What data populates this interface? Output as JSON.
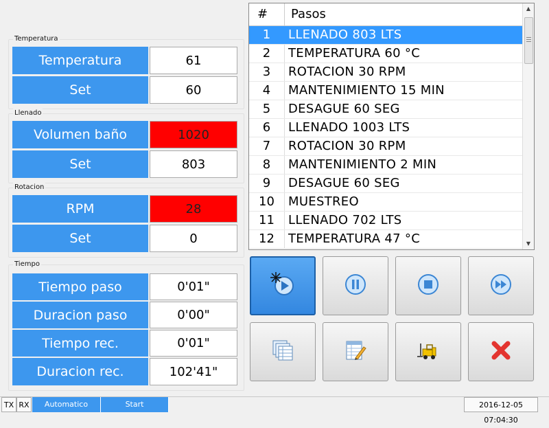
{
  "temperatura": {
    "group_title": "Temperatura",
    "main_label": "Temperatura",
    "main_value": "61",
    "set_label": "Set",
    "set_value": "60"
  },
  "llenado": {
    "group_title": "Llenado",
    "main_label": "Volumen baño",
    "main_value": "1020",
    "set_label": "Set",
    "set_value": "803"
  },
  "rotacion": {
    "group_title": "Rotacion",
    "main_label": "RPM",
    "main_value": "28",
    "set_label": "Set",
    "set_value": "0"
  },
  "tiempo": {
    "group_title": "Tiempo",
    "rows": [
      {
        "label": "Tiempo paso",
        "value": "0'01\""
      },
      {
        "label": "Duracion paso",
        "value": "0'00\""
      },
      {
        "label": "Tiempo rec.",
        "value": "0'01\""
      },
      {
        "label": "Duracion rec.",
        "value": "102'41\""
      }
    ]
  },
  "steps": {
    "header_num": "#",
    "header_name": "Pasos",
    "selected_index": 0,
    "rows": [
      {
        "num": "1",
        "name": "LLENADO 803 LTS"
      },
      {
        "num": "2",
        "name": "TEMPERATURA 60 °C"
      },
      {
        "num": "3",
        "name": "ROTACION 30 RPM"
      },
      {
        "num": "4",
        "name": "MANTENIMIENTO 15 MIN"
      },
      {
        "num": "5",
        "name": "DESAGUE 60 SEG"
      },
      {
        "num": "6",
        "name": "LLENADO 1003 LTS"
      },
      {
        "num": "7",
        "name": "ROTACION 30 RPM"
      },
      {
        "num": "8",
        "name": "MANTENIMIENTO 2 MIN"
      },
      {
        "num": "9",
        "name": "DESAGUE 60 SEG"
      },
      {
        "num": "10",
        "name": "MUESTREO"
      },
      {
        "num": "11",
        "name": "LLENADO 702 LTS"
      },
      {
        "num": "12",
        "name": "TEMPERATURA 47 °C"
      }
    ]
  },
  "buttons": [
    {
      "icon": "play-icon",
      "active": true
    },
    {
      "icon": "pause-icon",
      "active": false
    },
    {
      "icon": "stop-icon",
      "active": false
    },
    {
      "icon": "fast-forward-icon",
      "active": false
    },
    {
      "icon": "recipes-list-icon",
      "active": false
    },
    {
      "icon": "edit-sheet-icon",
      "active": false
    },
    {
      "icon": "forklift-icon",
      "active": false
    },
    {
      "icon": "close-x-icon",
      "active": false
    }
  ],
  "statusbar": {
    "tx": "TX",
    "rx": "RX",
    "mode": "Automatico",
    "state": "Start",
    "datetime": "2016-12-05 07:04:30"
  },
  "colors": {
    "accent_blue": "#3d97ee",
    "selected_row": "#3399ff",
    "alarm_red": "#ff0000",
    "close_red": "#e3342f"
  }
}
